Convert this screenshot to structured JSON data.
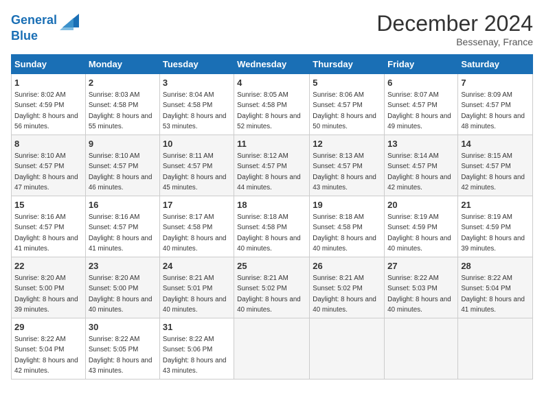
{
  "header": {
    "logo_line1": "General",
    "logo_line2": "Blue",
    "month_title": "December 2024",
    "location": "Bessenay, France"
  },
  "weekdays": [
    "Sunday",
    "Monday",
    "Tuesday",
    "Wednesday",
    "Thursday",
    "Friday",
    "Saturday"
  ],
  "weeks": [
    [
      {
        "day": "1",
        "sunrise": "8:02 AM",
        "sunset": "4:59 PM",
        "daylight": "8 hours and 56 minutes."
      },
      {
        "day": "2",
        "sunrise": "8:03 AM",
        "sunset": "4:58 PM",
        "daylight": "8 hours and 55 minutes."
      },
      {
        "day": "3",
        "sunrise": "8:04 AM",
        "sunset": "4:58 PM",
        "daylight": "8 hours and 53 minutes."
      },
      {
        "day": "4",
        "sunrise": "8:05 AM",
        "sunset": "4:58 PM",
        "daylight": "8 hours and 52 minutes."
      },
      {
        "day": "5",
        "sunrise": "8:06 AM",
        "sunset": "4:57 PM",
        "daylight": "8 hours and 50 minutes."
      },
      {
        "day": "6",
        "sunrise": "8:07 AM",
        "sunset": "4:57 PM",
        "daylight": "8 hours and 49 minutes."
      },
      {
        "day": "7",
        "sunrise": "8:09 AM",
        "sunset": "4:57 PM",
        "daylight": "8 hours and 48 minutes."
      }
    ],
    [
      {
        "day": "8",
        "sunrise": "8:10 AM",
        "sunset": "4:57 PM",
        "daylight": "8 hours and 47 minutes."
      },
      {
        "day": "9",
        "sunrise": "8:10 AM",
        "sunset": "4:57 PM",
        "daylight": "8 hours and 46 minutes."
      },
      {
        "day": "10",
        "sunrise": "8:11 AM",
        "sunset": "4:57 PM",
        "daylight": "8 hours and 45 minutes."
      },
      {
        "day": "11",
        "sunrise": "8:12 AM",
        "sunset": "4:57 PM",
        "daylight": "8 hours and 44 minutes."
      },
      {
        "day": "12",
        "sunrise": "8:13 AM",
        "sunset": "4:57 PM",
        "daylight": "8 hours and 43 minutes."
      },
      {
        "day": "13",
        "sunrise": "8:14 AM",
        "sunset": "4:57 PM",
        "daylight": "8 hours and 42 minutes."
      },
      {
        "day": "14",
        "sunrise": "8:15 AM",
        "sunset": "4:57 PM",
        "daylight": "8 hours and 42 minutes."
      }
    ],
    [
      {
        "day": "15",
        "sunrise": "8:16 AM",
        "sunset": "4:57 PM",
        "daylight": "8 hours and 41 minutes."
      },
      {
        "day": "16",
        "sunrise": "8:16 AM",
        "sunset": "4:57 PM",
        "daylight": "8 hours and 41 minutes."
      },
      {
        "day": "17",
        "sunrise": "8:17 AM",
        "sunset": "4:58 PM",
        "daylight": "8 hours and 40 minutes."
      },
      {
        "day": "18",
        "sunrise": "8:18 AM",
        "sunset": "4:58 PM",
        "daylight": "8 hours and 40 minutes."
      },
      {
        "day": "19",
        "sunrise": "8:18 AM",
        "sunset": "4:58 PM",
        "daylight": "8 hours and 40 minutes."
      },
      {
        "day": "20",
        "sunrise": "8:19 AM",
        "sunset": "4:59 PM",
        "daylight": "8 hours and 40 minutes."
      },
      {
        "day": "21",
        "sunrise": "8:19 AM",
        "sunset": "4:59 PM",
        "daylight": "8 hours and 39 minutes."
      }
    ],
    [
      {
        "day": "22",
        "sunrise": "8:20 AM",
        "sunset": "5:00 PM",
        "daylight": "8 hours and 39 minutes."
      },
      {
        "day": "23",
        "sunrise": "8:20 AM",
        "sunset": "5:00 PM",
        "daylight": "8 hours and 40 minutes."
      },
      {
        "day": "24",
        "sunrise": "8:21 AM",
        "sunset": "5:01 PM",
        "daylight": "8 hours and 40 minutes."
      },
      {
        "day": "25",
        "sunrise": "8:21 AM",
        "sunset": "5:02 PM",
        "daylight": "8 hours and 40 minutes."
      },
      {
        "day": "26",
        "sunrise": "8:21 AM",
        "sunset": "5:02 PM",
        "daylight": "8 hours and 40 minutes."
      },
      {
        "day": "27",
        "sunrise": "8:22 AM",
        "sunset": "5:03 PM",
        "daylight": "8 hours and 40 minutes."
      },
      {
        "day": "28",
        "sunrise": "8:22 AM",
        "sunset": "5:04 PM",
        "daylight": "8 hours and 41 minutes."
      }
    ],
    [
      {
        "day": "29",
        "sunrise": "8:22 AM",
        "sunset": "5:04 PM",
        "daylight": "8 hours and 42 minutes."
      },
      {
        "day": "30",
        "sunrise": "8:22 AM",
        "sunset": "5:05 PM",
        "daylight": "8 hours and 43 minutes."
      },
      {
        "day": "31",
        "sunrise": "8:22 AM",
        "sunset": "5:06 PM",
        "daylight": "8 hours and 43 minutes."
      },
      null,
      null,
      null,
      null
    ]
  ]
}
